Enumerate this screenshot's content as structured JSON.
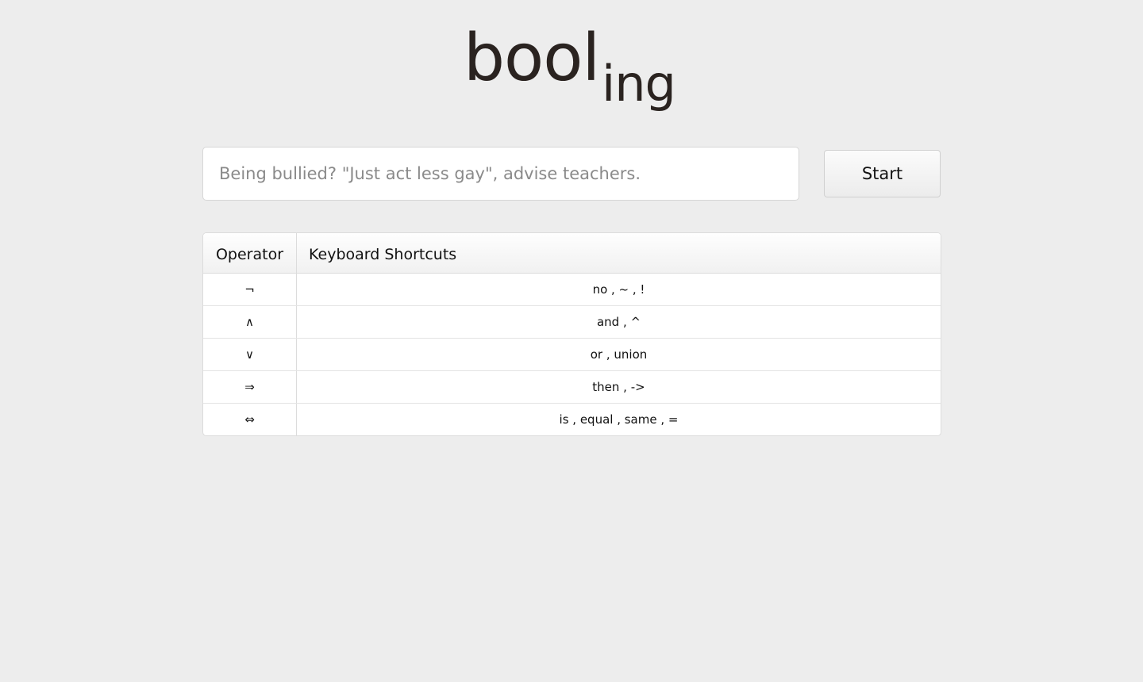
{
  "logo": {
    "main": "bool",
    "sub": "ing"
  },
  "search": {
    "placeholder": "Being bullied? \"Just act less gay\", advise teachers.",
    "value": ""
  },
  "start_button": {
    "label": "Start"
  },
  "shortcuts": {
    "headers": [
      "Operator",
      "Keyboard Shortcuts"
    ],
    "rows": [
      {
        "operator": "¬",
        "keys": "no , ~ , !"
      },
      {
        "operator": "∧",
        "keys": "and , ^"
      },
      {
        "operator": "∨",
        "keys": "or , union"
      },
      {
        "operator": "⇒",
        "keys": "then , ->"
      },
      {
        "operator": "⇔",
        "keys": "is , equal , same , ="
      }
    ]
  },
  "colors": {
    "background": "#ededed",
    "logo": "#2a2320",
    "placeholder": "#8a8a8a"
  }
}
